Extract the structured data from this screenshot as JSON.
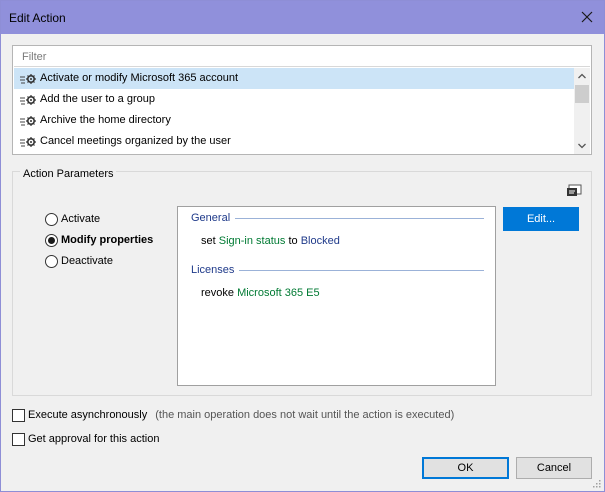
{
  "window": {
    "title": "Edit Action"
  },
  "list": {
    "filter_placeholder": "Filter",
    "items": [
      {
        "label": "Activate or modify Microsoft 365 account",
        "selected": true
      },
      {
        "label": "Add the user to a group",
        "selected": false
      },
      {
        "label": "Archive the home directory",
        "selected": false
      },
      {
        "label": "Cancel meetings organized by the user",
        "selected": false
      }
    ]
  },
  "params": {
    "group_label": "Action Parameters",
    "radios": [
      {
        "label": "Activate",
        "checked": false
      },
      {
        "label": "Modify properties",
        "checked": true
      },
      {
        "label": "Deactivate",
        "checked": false
      }
    ],
    "general": {
      "heading": "General",
      "line": {
        "pre": "set ",
        "property": "Sign-in status",
        "mid": " to ",
        "value": "Blocked"
      }
    },
    "licenses": {
      "heading": "Licenses",
      "line": {
        "pre": "revoke ",
        "value": "Microsoft 365 E5"
      }
    },
    "edit_label": "Edit..."
  },
  "options": {
    "async_label": "Execute asynchronously",
    "async_note": "(the main operation does not wait until the action is executed)",
    "approval_label": "Get approval for this action"
  },
  "buttons": {
    "ok": "OK",
    "cancel": "Cancel"
  },
  "colors": {
    "titlebar": "#9090db",
    "accent": "#0078d7",
    "selected_row": "#cce4f7"
  }
}
